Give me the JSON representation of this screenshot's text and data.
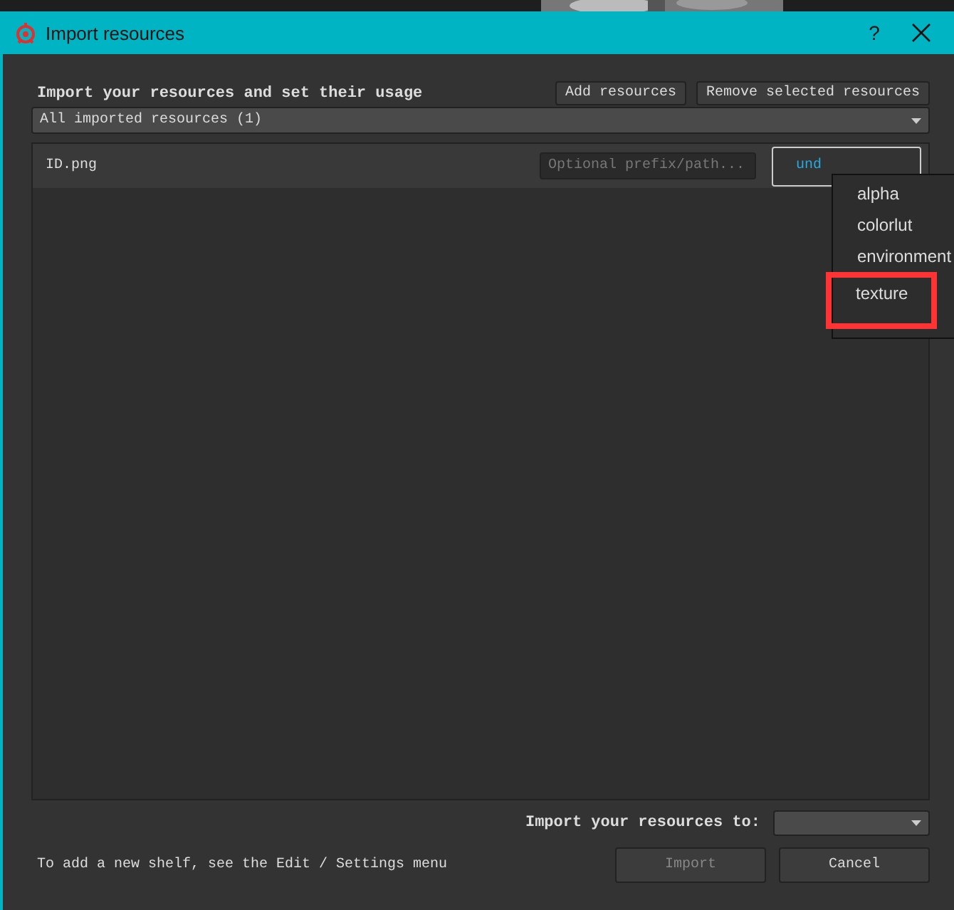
{
  "window": {
    "title": "Import resources",
    "help": "?"
  },
  "header": {
    "title": "Import your resources and set their usage",
    "buttons": [
      "Add resources",
      "Remove selected resources"
    ]
  },
  "filter": {
    "value": "All imported resources (1)"
  },
  "resources": [
    {
      "name": "ID.png",
      "prefix_placeholder": "Optional prefix/path...",
      "usage": "und"
    }
  ],
  "usage_menu": {
    "items": [
      {
        "label": "alpha",
        "highlighted": false
      },
      {
        "label": "colorlut",
        "highlighted": false
      },
      {
        "label": "environment",
        "highlighted": false
      },
      {
        "label": "texture",
        "highlighted": true
      }
    ]
  },
  "footer": {
    "destination_label": "Import your resources to:",
    "hint": "To add a new shelf, see the Edit / Settings menu",
    "buttons": [
      {
        "label": "Import",
        "disabled": true
      },
      {
        "label": "Cancel",
        "disabled": false
      }
    ]
  }
}
